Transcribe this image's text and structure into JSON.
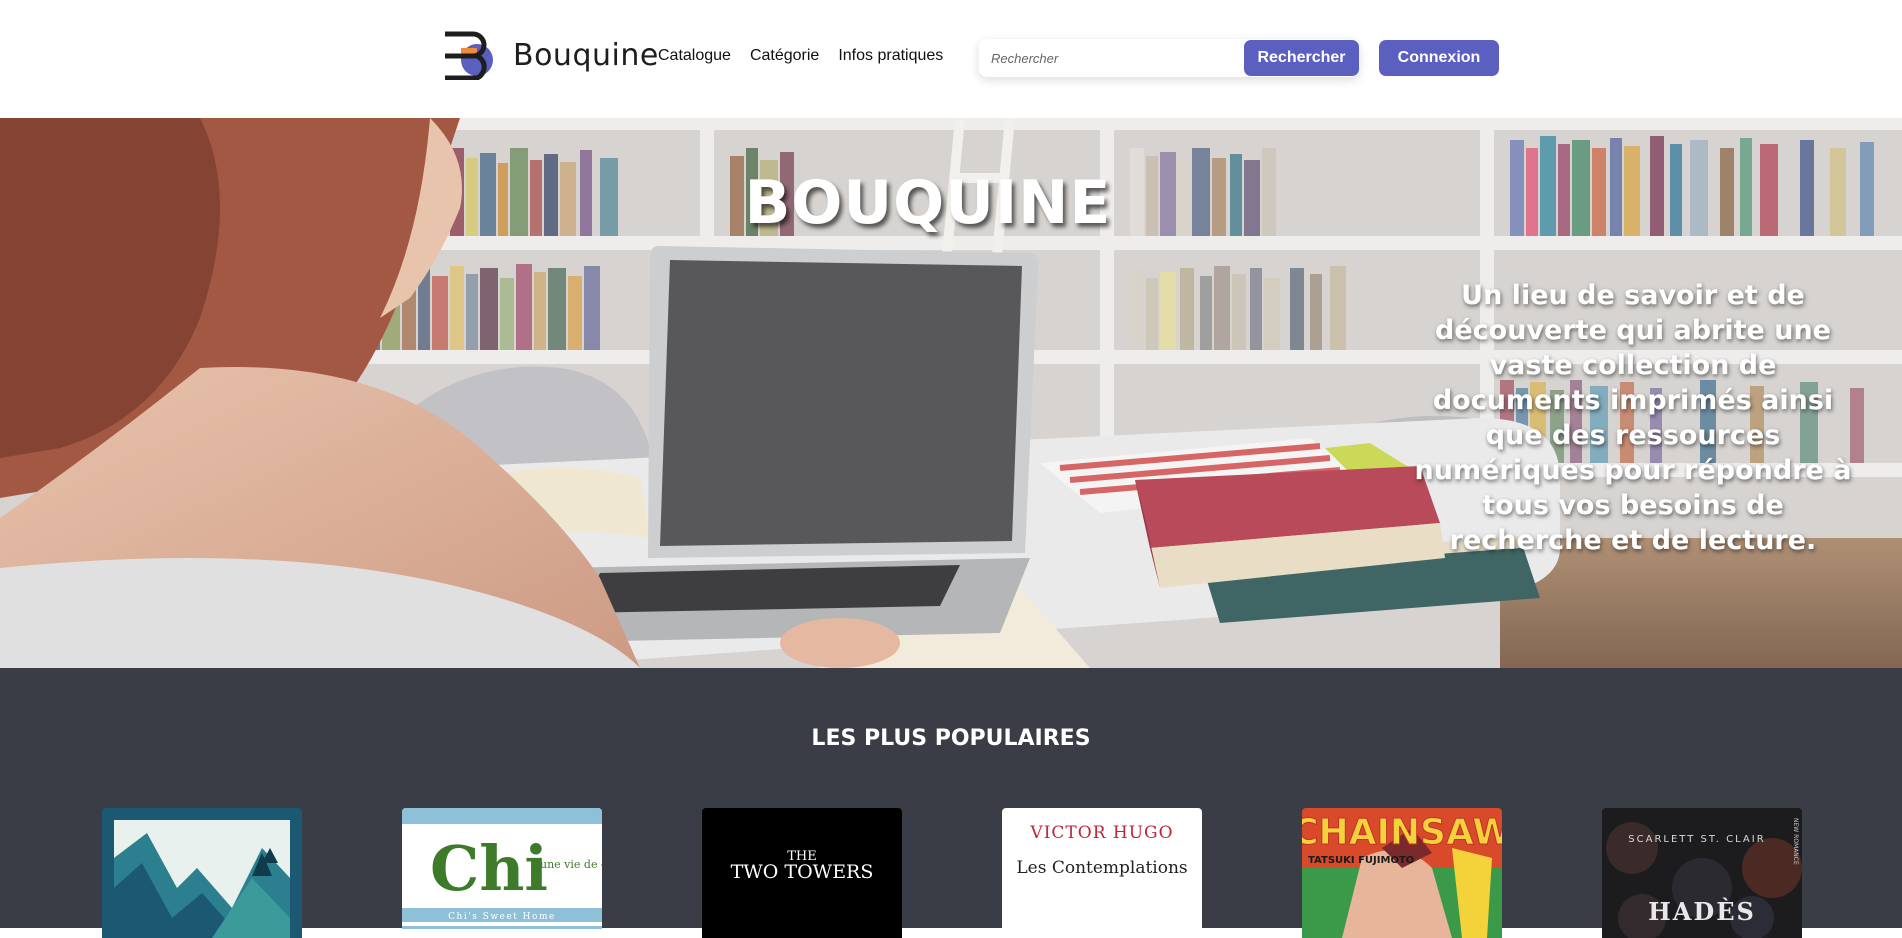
{
  "header": {
    "logo_text": "Bouquine",
    "nav": [
      {
        "label": "Catalogue"
      },
      {
        "label": "Catégorie"
      },
      {
        "label": "Infos pratiques"
      }
    ],
    "search": {
      "placeholder": "Rechercher",
      "value": ""
    },
    "search_button": "Rechercher",
    "login_button": "Connexion"
  },
  "hero": {
    "title": "BOUQUINE",
    "text": "Un lieu de savoir et de découverte qui abrite une vaste collection de documents imprimés ainsi que des ressources numériques pour répondre à tous vos besoins de recherche et de lecture."
  },
  "popular": {
    "title": "LES PLUS POPULAIRES",
    "books": [
      {
        "cover": "mountain-landscape"
      },
      {
        "cover_title": "Chi",
        "cover_subtitle": "une vie de chat",
        "cover_footer": "Chi's Sweet Home"
      },
      {
        "cover_small": "THE",
        "cover_title": "TWO TOWERS"
      },
      {
        "cover_author": "VICTOR HUGO",
        "cover_title": "Les Contemplations"
      },
      {
        "cover_title": "CHAINSAW",
        "cover_author": "TATSUKI FUJIMOTO"
      },
      {
        "cover_author": "SCARLETT ST. CLAIR",
        "cover_title": "HADÈS",
        "cover_badge": "NEW ROMANCE"
      }
    ]
  },
  "colors": {
    "accent": "#5b5fc0",
    "popular_bg": "#3a3d45",
    "logo_orange": "#f08a3c",
    "logo_purple": "#5b5fc0"
  }
}
